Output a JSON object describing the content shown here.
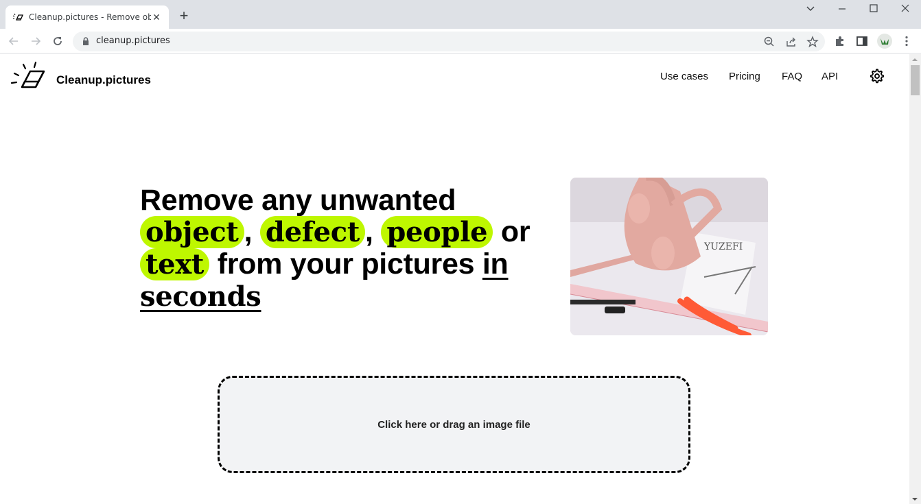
{
  "browser": {
    "tab_title": "Cleanup.pictures - Remove objec",
    "url": "cleanup.pictures",
    "icons": {
      "back": "arrow-left-icon",
      "forward": "arrow-right-icon",
      "reload": "reload-icon",
      "lock": "lock-icon",
      "zoom": "zoom-out-icon",
      "share": "share-icon",
      "bookmark": "star-icon",
      "extensions": "puzzle-icon",
      "sidepanel": "side-panel-icon",
      "menu": "kebab-menu-icon"
    }
  },
  "site": {
    "brand": "Cleanup.pictures",
    "nav": [
      "Use cases",
      "Pricing",
      "FAQ",
      "API"
    ],
    "accent_color": "#bef700"
  },
  "hero": {
    "line1": "Remove any unwanted",
    "highlight1": "object",
    "sep1": ",",
    "highlight2": "defect",
    "sep2": ",",
    "highlight3": "people",
    "or": "or",
    "highlight4": "text",
    "middle": "from your pictures",
    "underline1": "in",
    "underline2": "seconds",
    "image_alt": "Pink handbag with ruler, pens and compass on paper"
  },
  "dropzone": {
    "label": "Click here or drag an image file"
  }
}
